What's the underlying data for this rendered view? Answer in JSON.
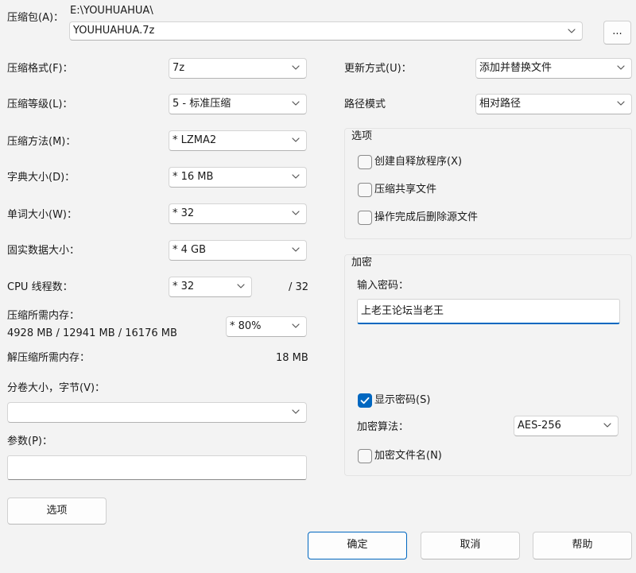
{
  "archive": {
    "label": "压缩包(A)：",
    "path": "E:\\YOUHUAHUA\\",
    "filename": "YOUHUAHUA.7z",
    "browse_label": "..."
  },
  "left": {
    "format": {
      "label": "压缩格式(F)：",
      "value": "7z"
    },
    "level": {
      "label": "压缩等级(L)：",
      "value": "5 - 标准压缩"
    },
    "method": {
      "label": "压缩方法(M)：",
      "value": "*  LZMA2"
    },
    "dict": {
      "label": "字典大小(D)：",
      "value": "*  16 MB"
    },
    "word": {
      "label": "单词大小(W)：",
      "value": "*  32"
    },
    "solid": {
      "label": "固实数据大小：",
      "value": "*  4 GB"
    },
    "threads": {
      "label": "CPU 线程数：",
      "value": "*  32",
      "max": "/ 32"
    },
    "mem": {
      "label": "压缩所需内存：",
      "detail": "4928 MB / 12941 MB / 16176 MB",
      "value": "*  80%"
    },
    "decomp": {
      "label": "解压缩所需内存：",
      "value": "18 MB"
    },
    "volume": {
      "label": "分卷大小，字节(V)：",
      "value": ""
    },
    "params": {
      "label": "参数(P)：",
      "value": ""
    },
    "options_button": "选项"
  },
  "right": {
    "update": {
      "label": "更新方式(U)：",
      "value": "添加并替换文件"
    },
    "pathmode": {
      "label": "路径模式",
      "value": "相对路径"
    },
    "options": {
      "title": "选项",
      "sfx": "创建自释放程序(X)",
      "shared": "压缩共享文件",
      "delete": "操作完成后删除源文件"
    },
    "encryption": {
      "title": "加密",
      "password_label": "输入密码：",
      "password": "上老王论坛当老王",
      "show_password": "显示密码(S)",
      "show_password_checked": true,
      "method_label": "加密算法：",
      "method": "AES-256",
      "encrypt_names": "加密文件名(N)"
    }
  },
  "buttons": {
    "ok": "确定",
    "cancel": "取消",
    "help": "帮助"
  },
  "colors": {
    "accent": "#0067c0",
    "background": "#f3f3f3"
  }
}
